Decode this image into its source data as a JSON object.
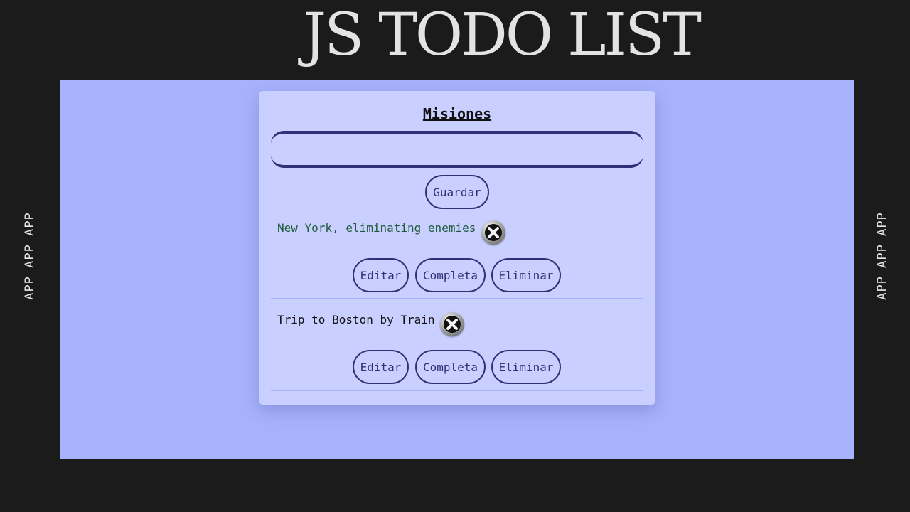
{
  "header": {
    "title": "JS TODO LIST"
  },
  "side_text": {
    "left": "APP APP APP",
    "right": "APP APP APP"
  },
  "card": {
    "title": "Misiones",
    "input": {
      "value": "",
      "placeholder": ""
    },
    "save_label": "Guardar"
  },
  "tasks": [
    {
      "text": "New York, eliminating enemies",
      "completed": true,
      "icon": "x-badge-icon",
      "actions": {
        "edit": "Editar",
        "complete": "Completa",
        "delete": "Eliminar"
      }
    },
    {
      "text": "Trip to Boston by Train",
      "completed": false,
      "icon": "x-badge-icon",
      "actions": {
        "edit": "Editar",
        "complete": "Completa",
        "delete": "Eliminar"
      }
    }
  ],
  "colors": {
    "background": "#1b1b1b",
    "stage": "#a7b2fc",
    "card": "#c9d0ff",
    "accent": "#2e3176",
    "completed_text": "#1f5a3a"
  }
}
